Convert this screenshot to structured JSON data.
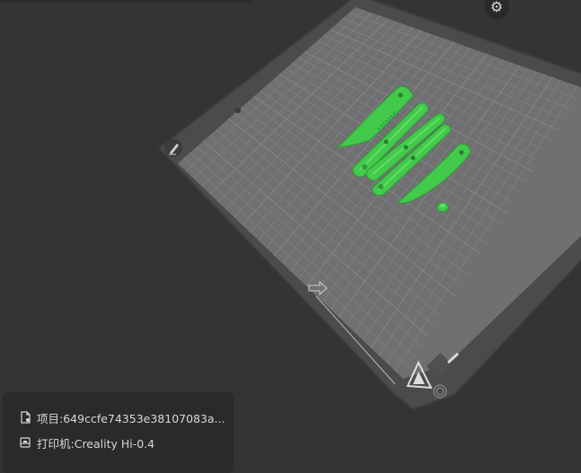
{
  "colors": {
    "background": "#343437",
    "plate_frame": "#4a4a4c",
    "plate_surface": "#6e6e70",
    "grid_line": "#858587",
    "model_green": "#43c94b",
    "panel_bg": "#2a2a2c",
    "text": "#d8d8d8"
  },
  "toolbar": {
    "settings_icon": "gear-icon"
  },
  "plate": {
    "edit_icon": "edit-pen-icon",
    "logo_icon": "triangle-logo-icon"
  },
  "info_panel": {
    "project_icon": "document-icon",
    "project": "项目:649ccfe74353e38107083a...",
    "printer_icon": "printer-icon",
    "printer": "打印机:Creality Hi-0.4"
  }
}
